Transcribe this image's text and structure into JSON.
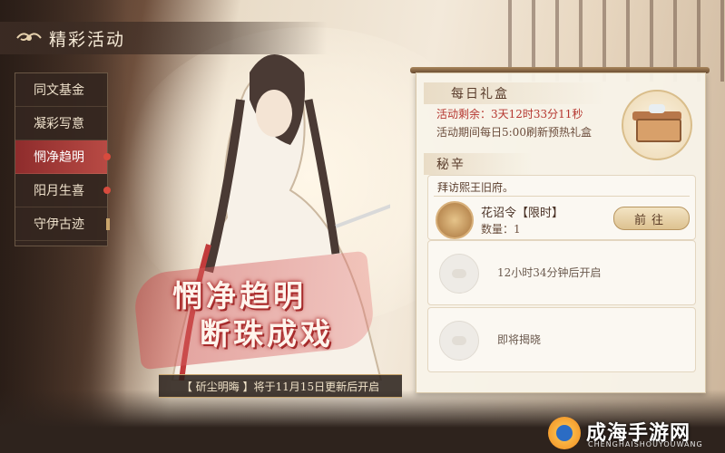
{
  "header": {
    "title": "精彩活动"
  },
  "sidebar": {
    "items": [
      {
        "label": "同文基金"
      },
      {
        "label": "凝彩写意"
      },
      {
        "label": "惘净趋明"
      },
      {
        "label": "阳月生喜"
      },
      {
        "label": "守伊古迹"
      }
    ]
  },
  "banner": {
    "line1": "惘净趋明",
    "line2": "断珠成戏"
  },
  "notice": "【 斫尘明晦 】将于11月15日更新后开启",
  "daily": {
    "title": "每日礼盒",
    "remain": "活动剩余：3天12时33分11秒",
    "refresh": "活动期间每日5:00刷新预热礼盒"
  },
  "secret": {
    "title": "秘辛",
    "visit": "拜访熙王旧府。",
    "item_name": "花诏令【限时】",
    "item_qty": "数量：1",
    "go_label": "前往",
    "locked1": "12小时34分钟后开启",
    "locked2": "即将揭晓"
  },
  "watermark": {
    "text": "成海手游网",
    "sub": "CHENGHAISHOUYOUWANG"
  }
}
